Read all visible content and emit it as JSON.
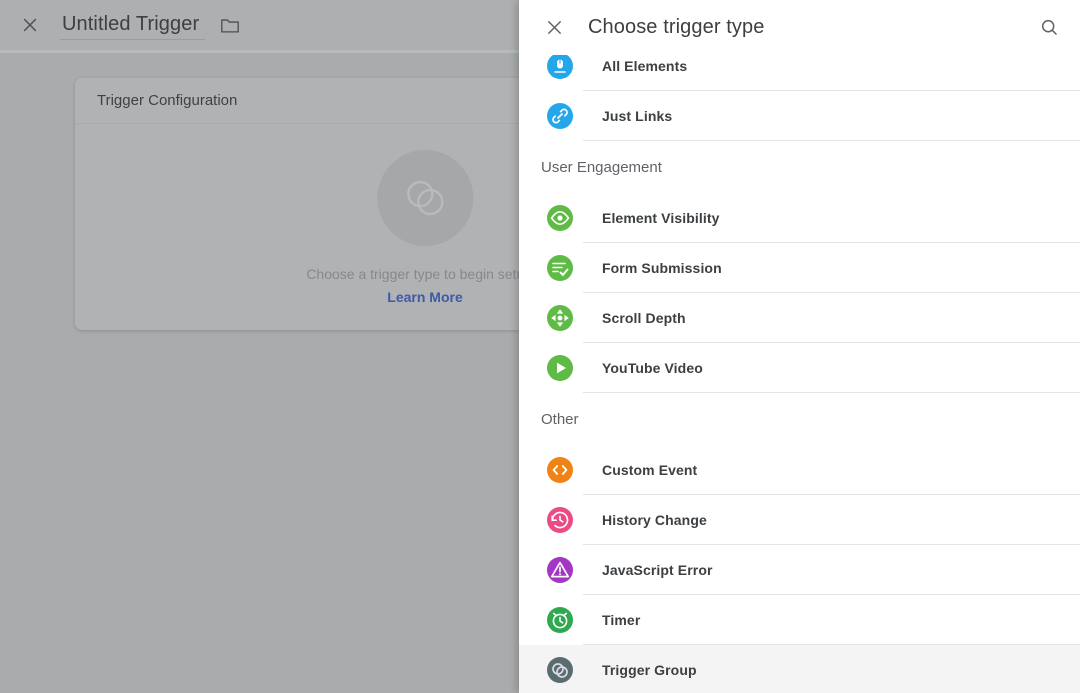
{
  "background": {
    "close_icon": "close-icon",
    "title": "Untitled Trigger",
    "folder_icon": "folder-icon",
    "card": {
      "header": "Trigger Configuration",
      "placeholder_icon": "trigger-group-placeholder-icon",
      "hint": "Choose a trigger type to begin setup...",
      "learn_more": "Learn More"
    }
  },
  "modal": {
    "close_icon": "close-icon",
    "title": "Choose trigger type",
    "search_icon": "search-icon",
    "sections": [
      {
        "name": "click",
        "heading": "",
        "items": [
          {
            "label": "All Elements",
            "icon": "mouse-click-icon",
            "color": "#23a7ea",
            "hovered": false
          },
          {
            "label": "Just Links",
            "icon": "link-icon",
            "color": "#23a7ea",
            "hovered": false
          }
        ]
      },
      {
        "name": "user-engagement",
        "heading": "User Engagement",
        "items": [
          {
            "label": "Element Visibility",
            "icon": "eye-icon",
            "color": "#5fbb46",
            "hovered": false
          },
          {
            "label": "Form Submission",
            "icon": "form-check-icon",
            "color": "#5fbb46",
            "hovered": false
          },
          {
            "label": "Scroll Depth",
            "icon": "scroll-arrows-icon",
            "color": "#5fbb46",
            "hovered": false
          },
          {
            "label": "YouTube Video",
            "icon": "play-icon",
            "color": "#5fbb46",
            "hovered": false
          }
        ]
      },
      {
        "name": "other",
        "heading": "Other",
        "items": [
          {
            "label": "Custom Event",
            "icon": "code-brackets-icon",
            "color": "#ef8316",
            "hovered": false
          },
          {
            "label": "History Change",
            "icon": "history-clock-icon",
            "color": "#ec4a87",
            "hovered": false
          },
          {
            "label": "JavaScript Error",
            "icon": "warning-triangle-icon",
            "color": "#a336c4",
            "hovered": false
          },
          {
            "label": "Timer",
            "icon": "alarm-clock-icon",
            "color": "#2fa84f",
            "hovered": false
          },
          {
            "label": "Trigger Group",
            "icon": "trigger-group-icon",
            "color": "#5b6b72",
            "hovered": true
          }
        ]
      }
    ]
  },
  "annotation": {
    "arrow_icon": "left-arrow-annotation",
    "color": "#22b022"
  }
}
